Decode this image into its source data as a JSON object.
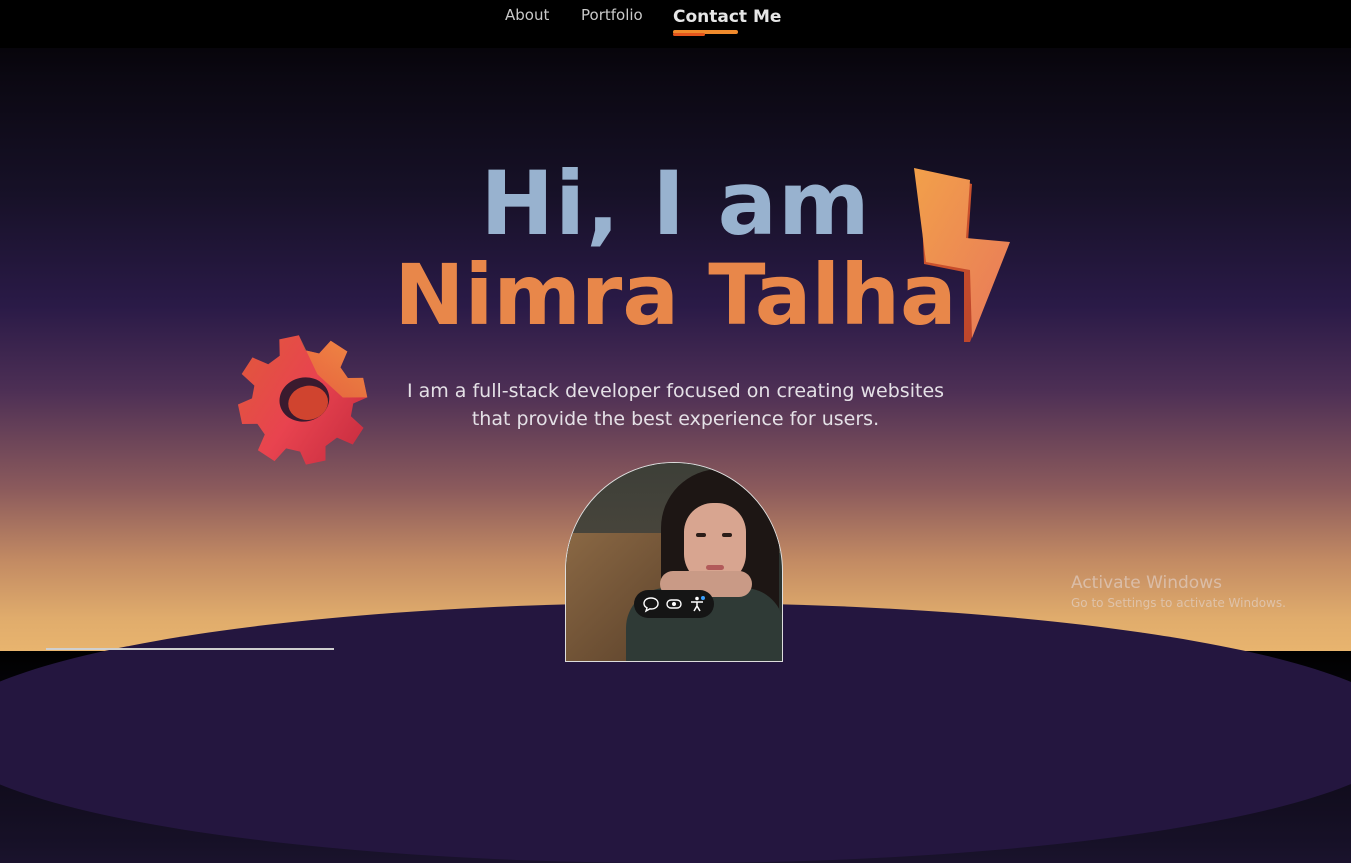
{
  "nav": {
    "items": [
      "About",
      "Portfolio",
      "Contact Me"
    ],
    "active_index": 2,
    "accent": "#f08a2c"
  },
  "hero": {
    "greeting": "Hi, I am",
    "name": "Nimra Talha",
    "intro_line1": "I am a full-stack developer focused on creating websites",
    "intro_line2": "that provide the best experience for users.",
    "greeting_color": "#98b2cf",
    "name_color": "#e8874a"
  },
  "decor": {
    "gear_icon": "gear-icon",
    "bolt_icon": "lightning-bolt-icon"
  },
  "toolbar_icons": [
    "chat-bubble-icon",
    "eye-icon",
    "accessibility-icon"
  ],
  "watermark": {
    "title": "Activate Windows",
    "subtitle": "Go to Settings to activate Windows."
  }
}
